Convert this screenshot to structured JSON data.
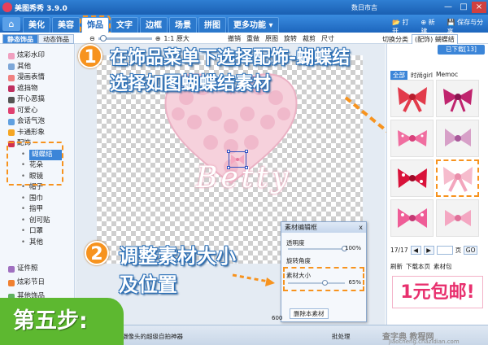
{
  "app": {
    "title": "美图秀秀 3.9.0",
    "user": "数日市吉"
  },
  "window": {
    "min": "—",
    "max": "□",
    "close": "×"
  },
  "tabs": [
    {
      "label": "美化"
    },
    {
      "label": "美容"
    },
    {
      "label": "饰品"
    },
    {
      "label": "文字"
    },
    {
      "label": "边框"
    },
    {
      "label": "场景"
    },
    {
      "label": "拼图"
    },
    {
      "label": "更多功能 ▾"
    }
  ],
  "top_right": {
    "open": "打开",
    "new": "新建",
    "save": "保存与分享"
  },
  "toolbar": {
    "side_tabs": [
      "静态饰品",
      "动态饰品"
    ],
    "ratio": "1:1 原大",
    "actions": [
      "撤销",
      "重做",
      "原图",
      "旋转",
      "裁剪",
      "尺寸"
    ],
    "category_label": "切换分类",
    "category_value": "(配饰) 蝴蝶结"
  },
  "left_menu": [
    {
      "label": "炫彩水印",
      "color": "#f0a0c0"
    },
    {
      "label": "其他",
      "color": "#7da7d8"
    },
    {
      "label": "漫画表情",
      "color": "#f08080"
    },
    {
      "label": "遮挡物",
      "color": "#c03060"
    },
    {
      "label": "开心恶搞",
      "color": "#555555"
    },
    {
      "label": "可爱心",
      "color": "#e04070"
    },
    {
      "label": "会话气泡",
      "color": "#60a0e0"
    },
    {
      "label": "卡通形象",
      "color": "#f5a623"
    },
    {
      "label": "配饰",
      "color": "#d03050"
    }
  ],
  "left_submenu": [
    "蝴蝶结",
    "花朵",
    "眼镜",
    "帽子",
    "围巾",
    "指甲",
    "创可贴",
    "口罩",
    "其他"
  ],
  "left_bottom": [
    "证件照",
    "炫彩节日",
    "其他饰品"
  ],
  "canvas": {
    "betty": "Betty"
  },
  "overlays": {
    "step1_num": "1",
    "step1_line1": "在饰品菜单下选择配饰-蝴蝶结",
    "step1_line2": "选择如图蝴蝶结素材",
    "step2_num": "2",
    "step2_line1": "调整素材大小",
    "step2_line2": "及位置",
    "step5": "第五步:"
  },
  "editor": {
    "title": "素材编辑框",
    "close": "x",
    "opacity_label": "透明度",
    "opacity_value": "100%",
    "opacity_fraction": 1.0,
    "rotate_label": "旋转角度",
    "size_label": "素材大小",
    "size_value": "65%",
    "size_fraction": 0.65,
    "delete_label": "删除本素材"
  },
  "right_panel": {
    "download": "已下载[13]",
    "subtabs": [
      "全部",
      "时尚girl",
      "Memoc"
    ],
    "pager_text": "17/17",
    "page_label": "页",
    "go_label": "GO",
    "buttons": [
      "刷新",
      "下载本页",
      "素材包"
    ],
    "promo": "1元包邮!"
  },
  "status": {
    "hint": "摄像头的超级自拍神器",
    "batch": "批处理",
    "zoom": "600",
    "watermark1": "查字典 教程网",
    "watermark2": "jiaocheng.chazidian.com"
  },
  "colors": {
    "accent": "#1d66bd",
    "highlight": "#f7931e",
    "step_green": "#5db830"
  }
}
